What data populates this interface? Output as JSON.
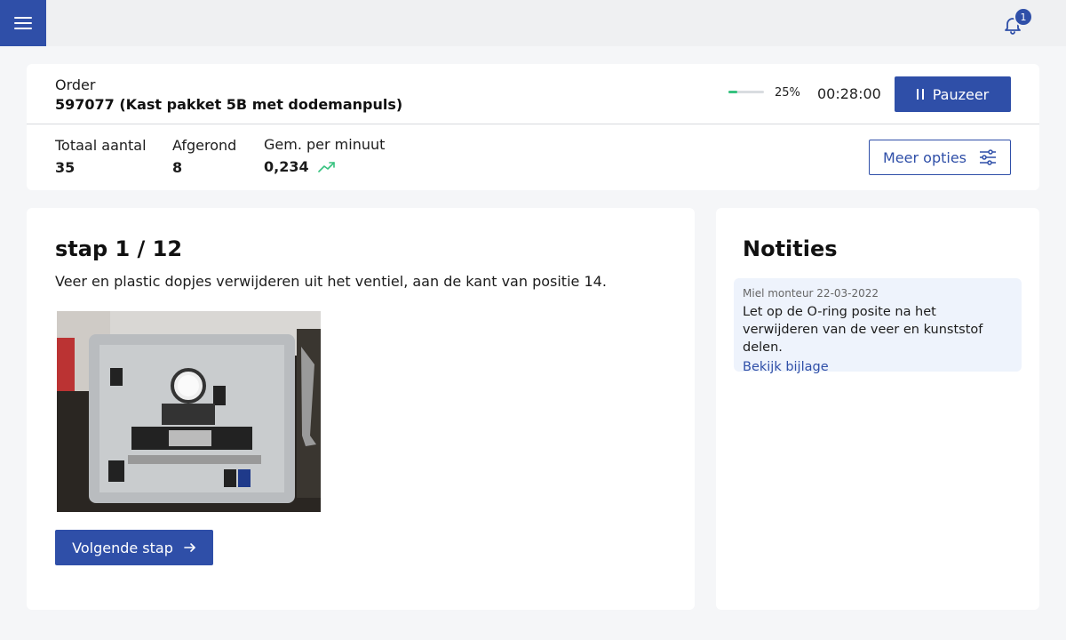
{
  "topbar": {
    "menu_icon": "menu-icon",
    "bell_icon": "bell-icon",
    "notification_count": "1",
    "accent_color": "#2f4fa8"
  },
  "order": {
    "label": "Order",
    "title": "597077 (Kast pakket 5B met dodemanpuls)",
    "progress_percent": 25,
    "progress_text": "25%",
    "timer": "00:28:00",
    "pause_label": "Pauzeer",
    "pause_icon": "pause-icon",
    "stats": [
      {
        "label": "Totaal aantal",
        "value": "35"
      },
      {
        "label": "Afgerond",
        "value": "8"
      },
      {
        "label": "Gem. per minuut",
        "value": "0,234",
        "icon": "trending-up-icon"
      }
    ],
    "more_label": "Meer opties",
    "more_icon": "sliders-icon",
    "progress_color": "#36c27f"
  },
  "step": {
    "title": "stap 1 / 12",
    "description": "Veer en plastic dopjes verwijderen uit het ventiel, aan de kant van positie 14.",
    "next_label": "Volgende stap",
    "next_icon": "arrow-right-icon"
  },
  "notes": {
    "title": "Notities",
    "items": [
      {
        "meta": "Miel monteur 22-03-2022",
        "text": "Let op de O-ring posite na het verwijderen van de veer en kunststof delen.",
        "link": "Bekijk bijlage"
      }
    ]
  }
}
